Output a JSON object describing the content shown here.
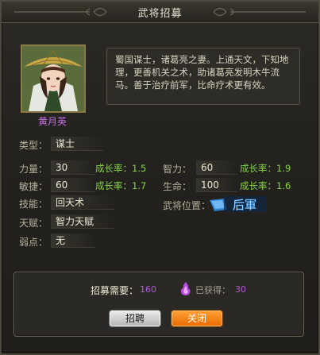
{
  "window": {
    "title": "武将招募"
  },
  "hero": {
    "name": "黄月英",
    "bio": "蜀国谋士，诸葛亮之妻。上通天文，下知地理，更善机关之术，助诸葛亮发明木牛流马。善于治疗前军，比命疗术更有效。"
  },
  "stats": {
    "type_label": "类型：",
    "type_value": "谋士",
    "strength_label": "力量：",
    "strength_value": "30",
    "strength_growth": "成长率：1.5",
    "intellect_label": "智力：",
    "intellect_value": "60",
    "intellect_growth": "成长率：1.9",
    "agility_label": "敏捷：",
    "agility_value": "60",
    "agility_growth": "成长率：1.7",
    "life_label": "生命：",
    "life_value": "100",
    "life_growth": "成长率：1.6",
    "skill_label": "技能：",
    "skill_value": "回天术",
    "position_label": "武将位置：",
    "position_value": "后軍",
    "talent_label": "天赋：",
    "talent_value": "智力天赋",
    "weakness_label": "弱点：",
    "weakness_value": "无"
  },
  "recruit": {
    "need_label": "招募需要：",
    "need_value": "160",
    "have_label": "已获得：",
    "have_value": "30"
  },
  "buttons": {
    "recruit": "招聘",
    "close": "关闭"
  },
  "icons": {
    "soul": "purple-soul-flame-icon",
    "position_badge": "rear-army-flag-icon"
  },
  "colors": {
    "growth": "#86d24a",
    "hero_name": "#c46fe8",
    "count": "#b05bd6",
    "close_button": "#f07c0e"
  }
}
